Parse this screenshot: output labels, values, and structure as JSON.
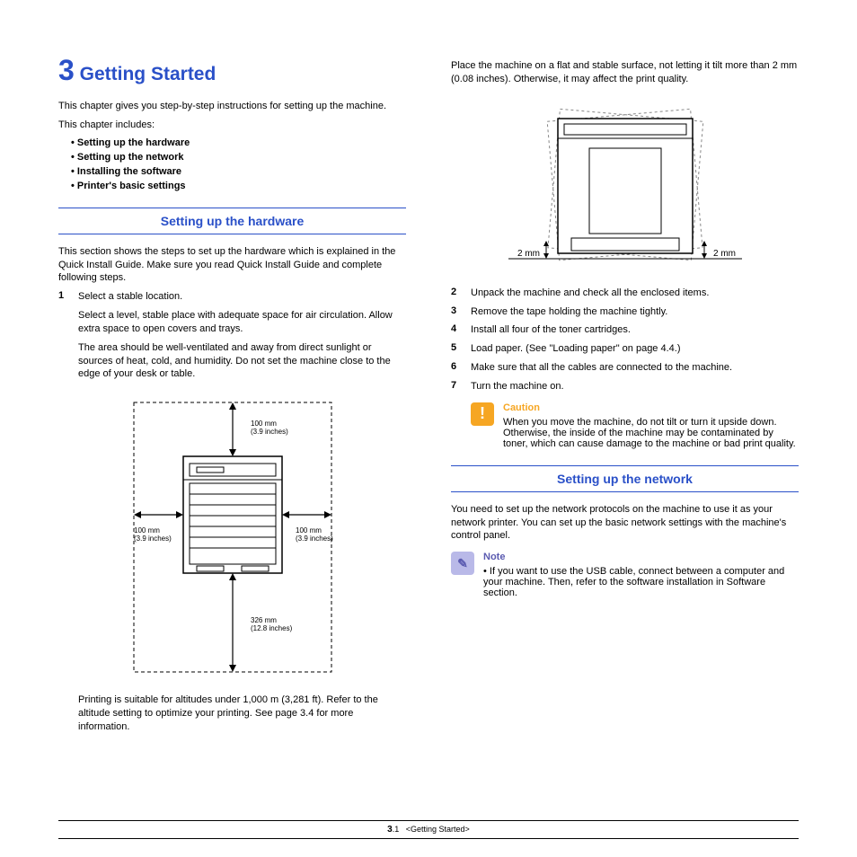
{
  "chapter": {
    "number": "3",
    "title": "Getting Started"
  },
  "intro_p1": "This chapter gives you step-by-step instructions for setting up the machine.",
  "intro_p2": "This chapter includes:",
  "contents": [
    "Setting up the hardware",
    "Setting up the network",
    "Installing the software",
    "Printer's basic settings"
  ],
  "section1": {
    "heading": "Setting up the hardware",
    "intro": "This section shows the steps to set up the hardware which is explained in the Quick Install Guide. Make sure you read Quick Install Guide and complete following steps.",
    "step1": {
      "n": "1",
      "text": "Select a stable location."
    },
    "sub1": "Select a level, stable place with adequate space for air circulation. Allow extra space to open covers and trays.",
    "sub2": "The area should be well-ventilated and away from direct sunlight or sources of heat, cold, and humidity. Do not set the machine close to the edge of your desk or table.",
    "diagram": {
      "top": "100 mm\n(3.9 inches)",
      "left": "100 mm\n(3.9 inches)",
      "right": "100 mm\n(3.9 inches)",
      "bottom": "326 mm\n(12.8 inches)"
    },
    "sub3": "Printing is suitable for altitudes under 1,000 m (3,281 ft). Refer to the altitude setting to optimize your printing. See page 3.4 for more information."
  },
  "col2": {
    "place": "Place the machine on a flat and stable surface, not letting it tilt more than 2 mm (0.08 inches). Otherwise, it may affect the print quality.",
    "label_left": "2 mm",
    "label_right": "2 mm",
    "steps": [
      {
        "n": "2",
        "text": "Unpack the machine and check all the enclosed items."
      },
      {
        "n": "3",
        "text": "Remove the tape holding the machine tightly."
      },
      {
        "n": "4",
        "text": "Install all four of the toner cartridges."
      },
      {
        "n": "5",
        "text": "Load paper. (See \"Loading paper\" on page 4.4.)"
      },
      {
        "n": "6",
        "text": "Make sure that all the cables are connected to the machine."
      },
      {
        "n": "7",
        "text": "Turn the machine on."
      }
    ],
    "caution": {
      "title": "Caution",
      "body": "When you move the machine, do not tilt or turn it upside down. Otherwise, the inside of the machine may be contaminated by toner, which can cause damage to the machine or bad print quality."
    }
  },
  "section2": {
    "heading": "Setting up the network",
    "intro": "You need to set up the network protocols on the machine to use it as your network printer. You can set up the basic network settings with the machine's control panel.",
    "note": {
      "title": "Note",
      "body": "If you want to use the USB cable, connect between a computer and your machine. Then, refer to the software installation in Software section."
    }
  },
  "footer": {
    "page_chapter": "3",
    "page_sub": ".1",
    "title": "<Getting Started>"
  }
}
